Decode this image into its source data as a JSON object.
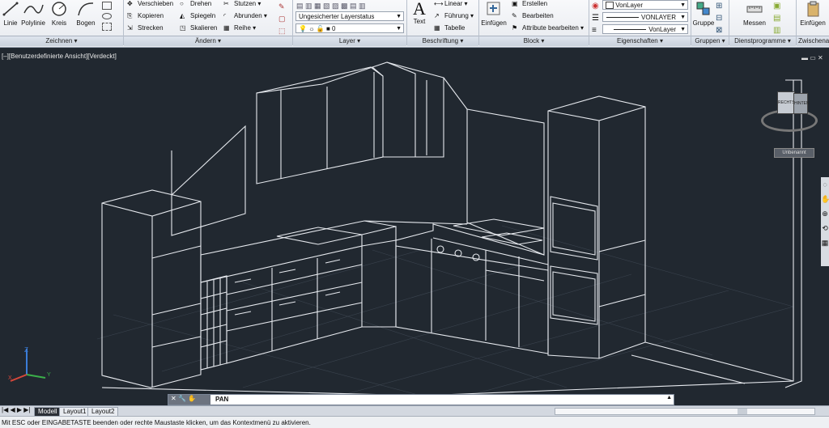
{
  "ribbon": {
    "draw": {
      "items": [
        "Linie",
        "Polylinie",
        "Kreis",
        "Bogen"
      ],
      "group": "Zeichnen ▾"
    },
    "modify": {
      "items": [
        "Verschieben",
        "Drehen",
        "Stutzen ▾",
        "Kopieren",
        "Spiegeln",
        "Abrunden ▾",
        "Strecken",
        "Skalieren",
        "Reihe ▾"
      ],
      "group": "Ändern ▾"
    },
    "layer": {
      "status": "Ungesicherter Layerstatus",
      "current": "0",
      "group": "Layer ▾"
    },
    "annotation": {
      "text": "Text",
      "items": [
        "Linear ▾",
        "Führung ▾",
        "Tabelle"
      ],
      "group": "Beschriftung ▾"
    },
    "block": {
      "insert": "Einfügen",
      "items": [
        "Erstellen",
        "Bearbeiten",
        "Attribute bearbeiten ▾"
      ],
      "group": "Block ▾"
    },
    "properties": {
      "items": [
        "VonLayer",
        "VONLAYER",
        "VonLayer"
      ],
      "group": "Eigenschaften ▾"
    },
    "groups": {
      "label": "Gruppe",
      "group": "Gruppen ▾"
    },
    "utilities": {
      "label": "Messen",
      "group": "Dienstprogramme ▾"
    },
    "clipboard": {
      "label": "Einfügen",
      "group": "Zwischenabl"
    }
  },
  "viewport": {
    "label": "[–][Benutzerdefinierte Ansicht][Verdeckt]",
    "viewcube": {
      "face1": "RECHTS",
      "face2": "HINTEN",
      "wcs": "Unbenannt"
    },
    "ucs": {
      "x": "X",
      "y": "Y",
      "z": "Z"
    }
  },
  "command": {
    "text": "PAN"
  },
  "tabs": [
    "Modell",
    "Layout1",
    "Layout2"
  ],
  "status": "Mit ESC oder EINGABETASTE beenden oder rechte Maustaste klicken, um das Kontextmenü zu aktivieren.",
  "colors": {
    "background": "#212830",
    "lines": "#e6e9ee",
    "ribbon": "#eef1f5"
  }
}
